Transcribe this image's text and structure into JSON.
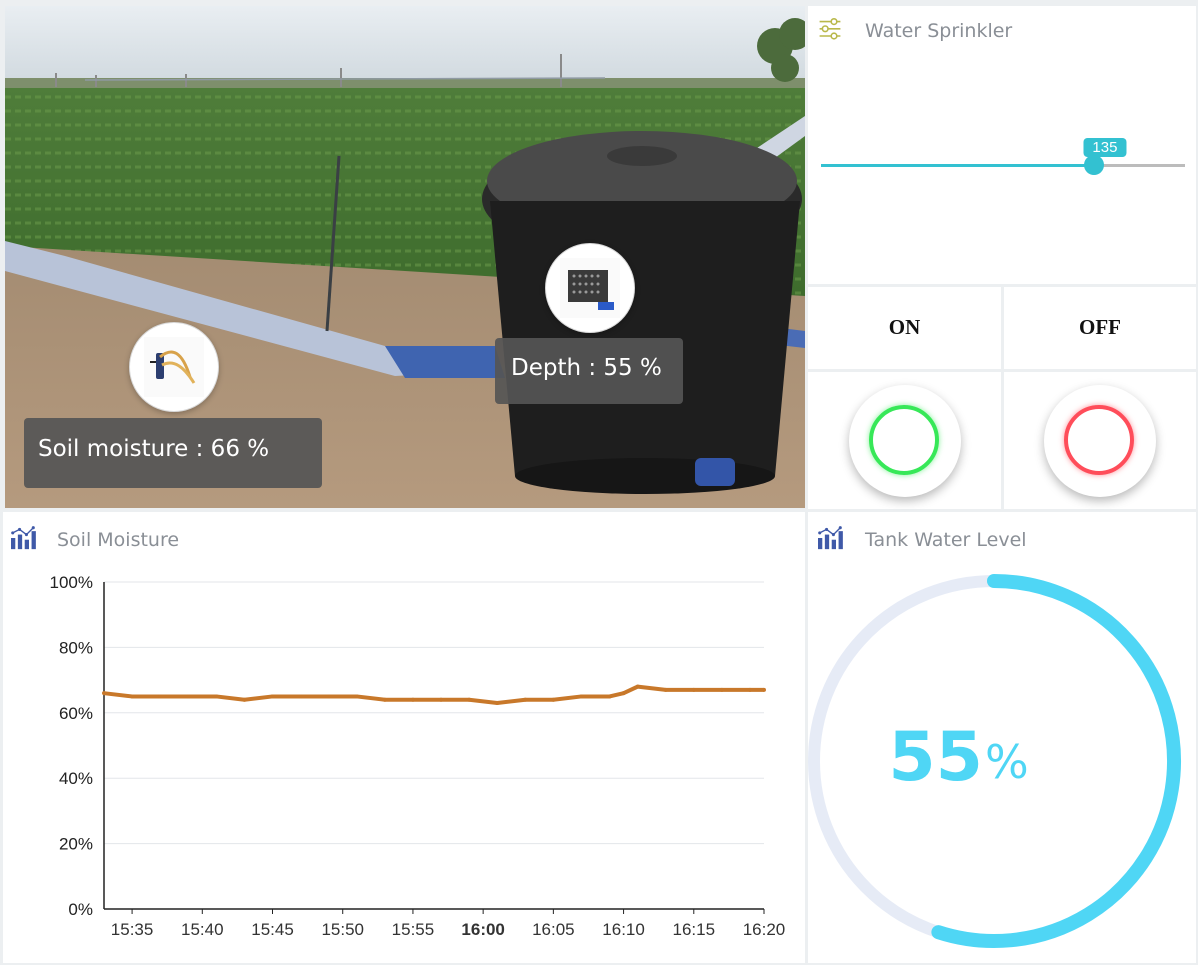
{
  "colors": {
    "accent": "#33c1d1",
    "chart_line": "#c8782a",
    "gauge": "#4fd6f5",
    "gauge_track": "#e6ebf6",
    "on_ring": "#37e858",
    "off_ring": "#ff4d5a"
  },
  "photo": {
    "soil_sensor_text": "Soil moisture :  66 %",
    "depth_sensor_text": "Depth :  55 %",
    "soil_sensor_icon": "soil-moisture-sensor-icon",
    "depth_sensor_icon": "ultrasonic-sensor-icon"
  },
  "sprinkler": {
    "title": "Water Sprinkler",
    "icon": "sliders-icon",
    "value": 135,
    "value_label": "135",
    "min": 0,
    "max": 180
  },
  "switch": {
    "on_label": "ON",
    "off_label": "OFF"
  },
  "soil_chart": {
    "title": "Soil Moisture",
    "icon": "bar-chart-icon"
  },
  "tank": {
    "title": "Tank Water Level",
    "icon": "bar-chart-icon",
    "value_number": "55",
    "value_unit": "%",
    "percent": 55
  },
  "chart_data": {
    "type": "line",
    "title": "Soil Moisture",
    "xlabel": "",
    "ylabel": "",
    "x_ticks": [
      "15:35",
      "15:40",
      "15:45",
      "15:50",
      "15:55",
      "16:00",
      "16:05",
      "16:10",
      "16:15",
      "16:20"
    ],
    "y_ticks": [
      "0%",
      "20%",
      "40%",
      "60%",
      "80%",
      "100%"
    ],
    "ylim": [
      0,
      100
    ],
    "xlim": [
      "15:33",
      "16:20"
    ],
    "grid": true,
    "series": [
      {
        "x": [
          "15:33",
          "15:35",
          "15:37",
          "15:39",
          "15:41",
          "15:43",
          "15:45",
          "15:47",
          "15:49",
          "15:51",
          "15:53",
          "15:55",
          "15:57",
          "15:59",
          "16:01",
          "16:03",
          "16:05",
          "16:07",
          "16:09",
          "16:10",
          "16:11",
          "16:13",
          "16:15",
          "16:17",
          "16:19",
          "16:20"
        ],
        "values": [
          66,
          65,
          65,
          65,
          65,
          64,
          65,
          65,
          65,
          65,
          64,
          64,
          64,
          64,
          63,
          64,
          64,
          65,
          65,
          66,
          68,
          67,
          67,
          67,
          67,
          67
        ]
      }
    ]
  }
}
